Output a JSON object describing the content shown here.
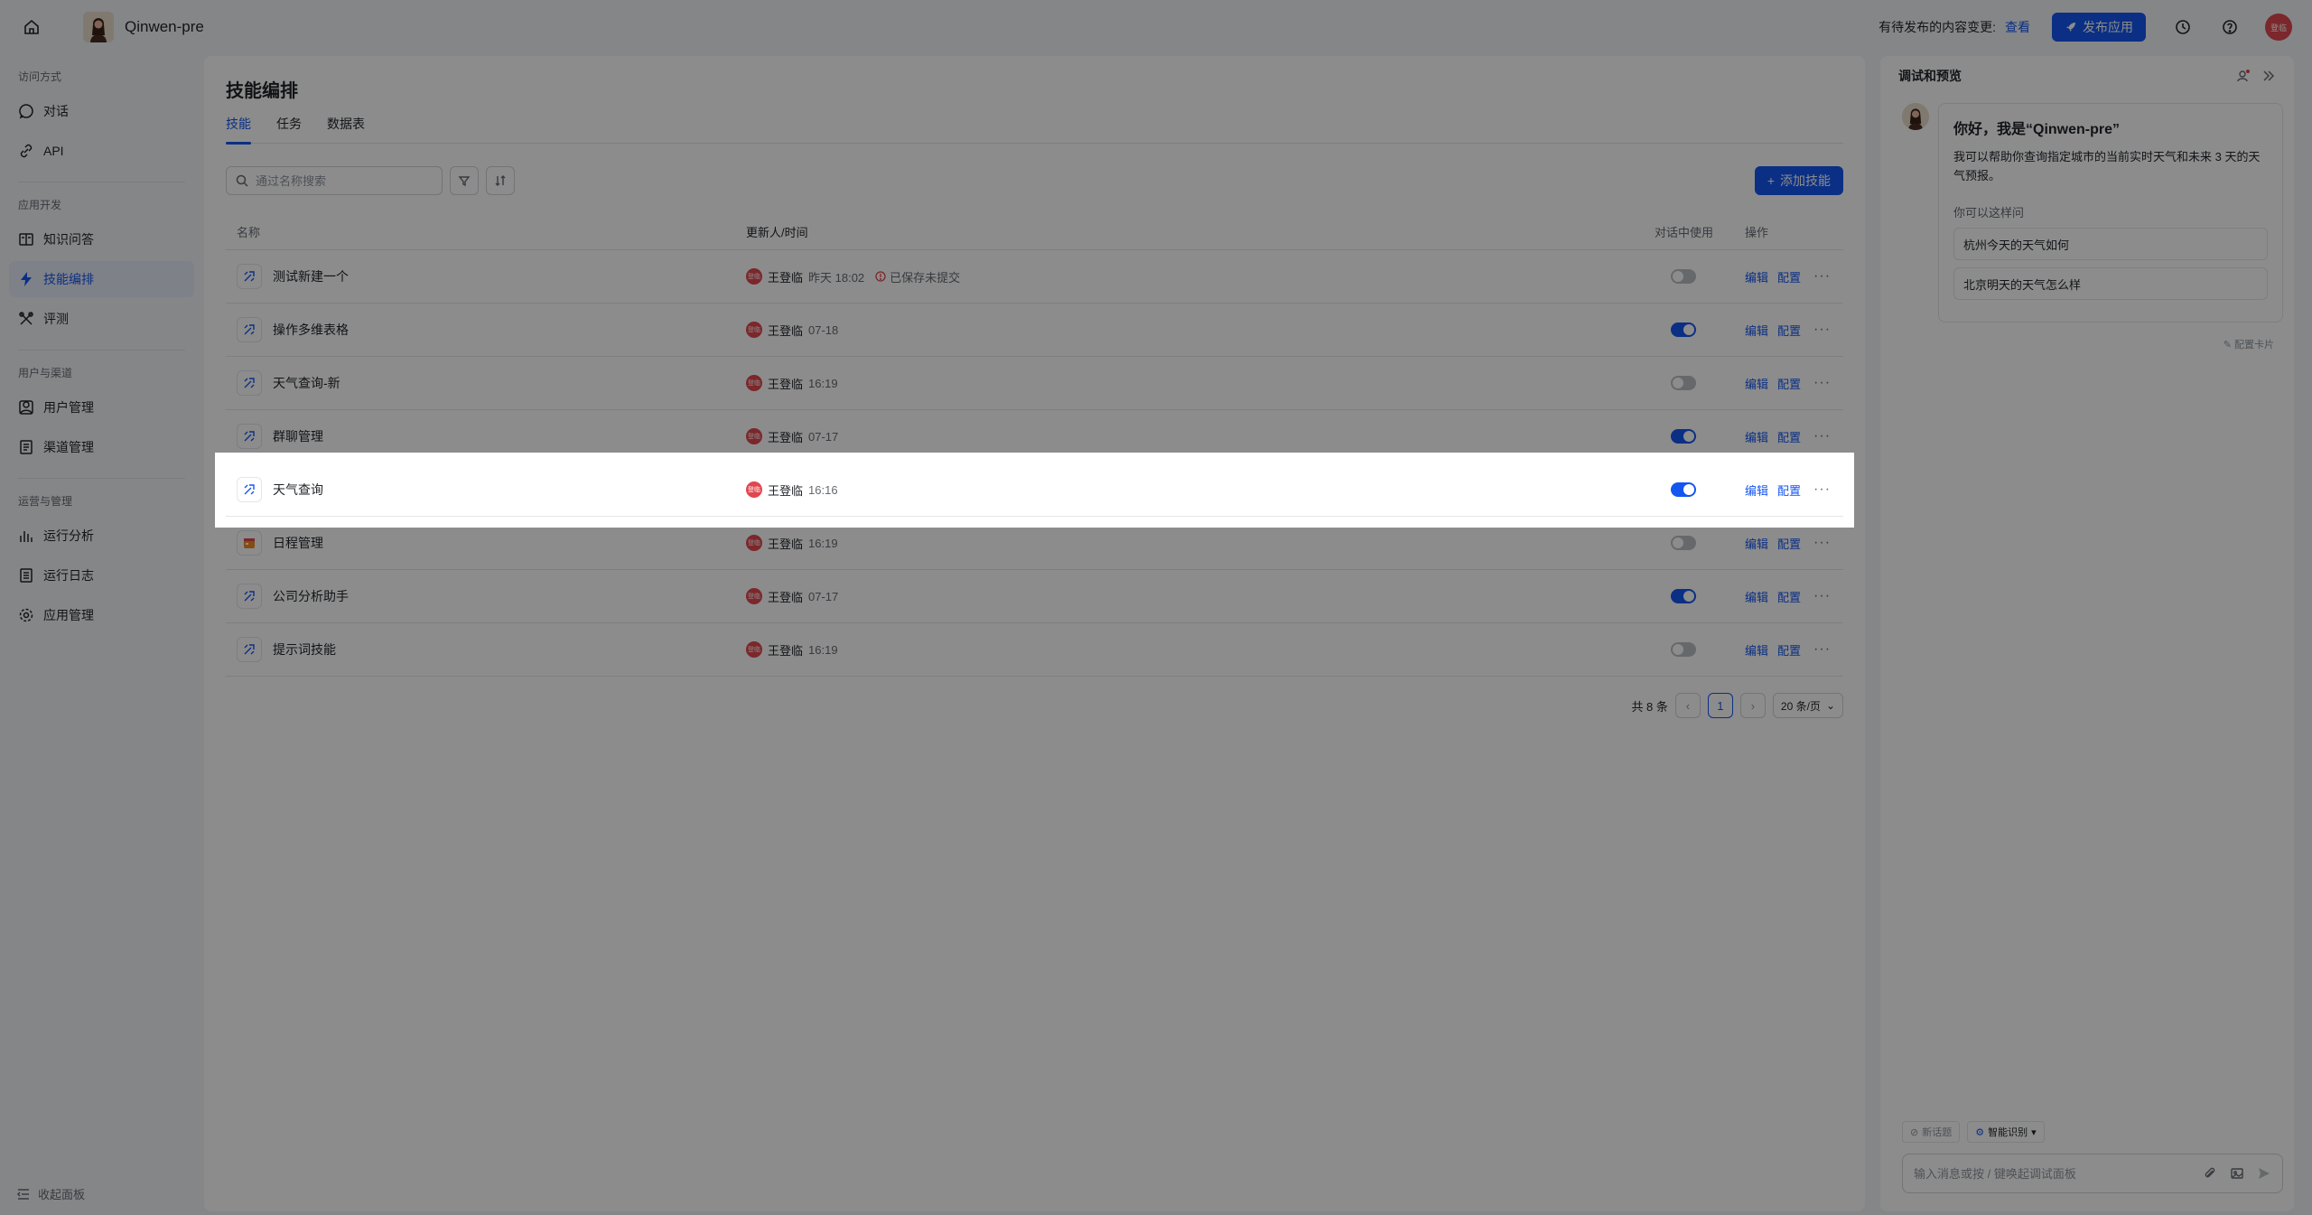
{
  "topbar": {
    "app_name": "Qinwen-pre",
    "pending_text": "有待发布的内容变更:",
    "pending_link": "查看",
    "publish_label": "发布应用",
    "user_initials": "登临"
  },
  "nav": {
    "groups": [
      {
        "title": "访问方式",
        "items": [
          {
            "label": "对话",
            "icon": "chat-icon"
          },
          {
            "label": "API",
            "icon": "link-icon"
          }
        ]
      },
      {
        "title": "应用开发",
        "items": [
          {
            "label": "知识问答",
            "icon": "book-icon"
          },
          {
            "label": "技能编排",
            "icon": "bolt-icon",
            "active": true
          },
          {
            "label": "评测",
            "icon": "tools-icon"
          }
        ]
      },
      {
        "title": "用户与渠道",
        "items": [
          {
            "label": "用户管理",
            "icon": "users-icon"
          },
          {
            "label": "渠道管理",
            "icon": "document-icon"
          }
        ]
      },
      {
        "title": "运营与管理",
        "items": [
          {
            "label": "运行分析",
            "icon": "bar-chart-icon"
          },
          {
            "label": "运行日志",
            "icon": "log-icon"
          },
          {
            "label": "应用管理",
            "icon": "gear-icon"
          }
        ]
      }
    ],
    "collapse_label": "收起面板"
  },
  "main": {
    "title": "技能编排",
    "tabs": [
      "技能",
      "任务",
      "数据表"
    ],
    "search_placeholder": "通过名称搜索",
    "add_label": "添加技能",
    "columns": {
      "name": "名称",
      "updated": "更新人/时间",
      "in_chat": "对话中使用",
      "ops": "操作"
    },
    "rows": [
      {
        "name": "测试新建一个",
        "user": "王登临",
        "time": "昨天 18:02",
        "note": "已保存未提交",
        "enabled": false,
        "icon": "skill-icon"
      },
      {
        "name": "操作多维表格",
        "user": "王登临",
        "time": "07-18",
        "note": "",
        "enabled": true,
        "icon": "skill-icon"
      },
      {
        "name": "天气查询-新",
        "user": "王登临",
        "time": "16:19",
        "note": "",
        "enabled": false,
        "icon": "skill-icon"
      },
      {
        "name": "群聊管理",
        "user": "王登临",
        "time": "07-17",
        "note": "",
        "enabled": true,
        "icon": "skill-icon"
      },
      {
        "name": "天气查询",
        "user": "王登临",
        "time": "16:16",
        "note": "",
        "enabled": true,
        "icon": "skill-icon",
        "highlight": true
      },
      {
        "name": "日程管理",
        "user": "王登临",
        "time": "16:19",
        "note": "",
        "enabled": false,
        "icon": "calendar-icon"
      },
      {
        "name": "公司分析助手",
        "user": "王登临",
        "time": "07-17",
        "note": "",
        "enabled": true,
        "icon": "skill-icon"
      },
      {
        "name": "提示词技能",
        "user": "王登临",
        "time": "16:19",
        "note": "",
        "enabled": false,
        "icon": "skill-icon"
      }
    ],
    "op_edit": "编辑",
    "op_config": "配置",
    "user_avatar_text": "登临",
    "pager": {
      "total": "共 8 条",
      "current": "1",
      "page_size": "20 条/页"
    }
  },
  "preview": {
    "title": "调试和预览",
    "greeting": "你好，我是“Qinwen-pre”",
    "intro": "我可以帮助你查询指定城市的当前实时天气和未来 3 天的天气预报。",
    "ask_label": "你可以这样问",
    "suggestions": [
      "杭州今天的天气如何",
      "北京明天的天气怎么样"
    ],
    "card_config": "配置卡片",
    "new_chat": "新话题",
    "mode": "智能识别",
    "input_placeholder": "输入消息或按 / 键唤起调试面板"
  },
  "colors": {
    "accent": "#1456f0",
    "avatar": "#e0474f"
  }
}
